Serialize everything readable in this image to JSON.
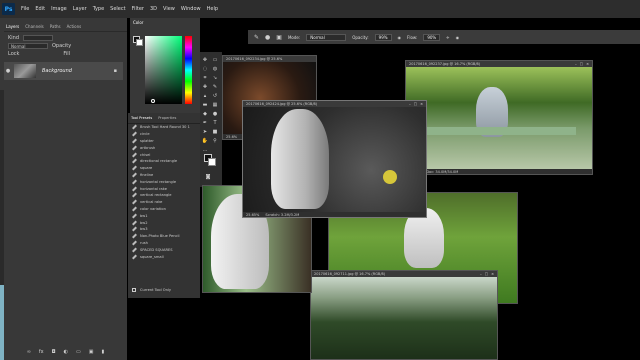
{
  "app": {
    "logo": "Ps"
  },
  "menu": [
    "File",
    "Edit",
    "Image",
    "Layer",
    "Type",
    "Select",
    "Filter",
    "3D",
    "View",
    "Window",
    "Help"
  ],
  "layers_panel": {
    "tabs": [
      "Layers",
      "Channels",
      "Paths",
      "Actions"
    ],
    "layer_name": "Background",
    "controls": [
      "Kind",
      "Normal",
      "Opacity",
      "Lock",
      "Fill"
    ]
  },
  "color_panel": {
    "tab": "Color"
  },
  "tool_presets": {
    "tabs": [
      "Tool Presets",
      "Properties"
    ],
    "items": [
      "Brush Tool Hard Round 30 1",
      "circle",
      "splatter",
      "artbrush",
      "chisel",
      "directional rectangle",
      "square",
      "fineline",
      "horizontal rectangle",
      "horizontal rake",
      "vertical rectangle",
      "vertical rake",
      "color variation",
      "bw1",
      "bw2",
      "bw3",
      "Non-Photo Blue Pencil",
      "rush",
      "SPACED SQUARES",
      "square_small"
    ],
    "footer": "Current Tool Only"
  },
  "options_bar": {
    "mode_label": "Mode:",
    "mode_value": "Normal",
    "opacity_label": "Opacity:",
    "opacity_value": "99%",
    "flow_label": "Flow:",
    "flow_value": "90%"
  },
  "windows": {
    "w1": {
      "title": "20170616_092234.jpg @ 25.6%",
      "status": "25.6%"
    },
    "w2": {
      "title": "20170616_092424.jpg @ 25.6% (RGB/8)",
      "status": "25.65%",
      "doc": "Scratch: 3.2M/3.2M"
    },
    "w3": {
      "title": "20170616_092237.jpg @ 16.7% (RGB/8)",
      "status": "16.67%",
      "doc": "Doc: 34.0M/34.0M"
    },
    "w4": {
      "title": "",
      "status": ""
    },
    "w5": {
      "title": "20170616_092711.jpg @ 16.7% (RGB/8)",
      "status": ""
    }
  },
  "colors": {
    "accent": "#31a8ff",
    "panel": "#383838",
    "menubar": "#2d2d2d"
  }
}
